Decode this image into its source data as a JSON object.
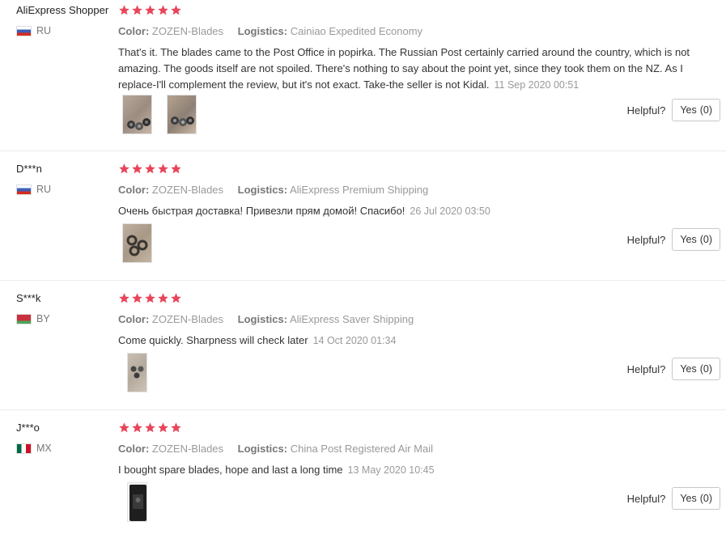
{
  "colors": {
    "star": "#e8455a",
    "muted": "#999999",
    "border": "#ebebeb"
  },
  "labels": {
    "color": "Color:",
    "logistics": "Logistics:",
    "helpful": "Helpful?",
    "yes": "Yes"
  },
  "reviews": [
    {
      "user": "AliExpress Shopper",
      "country": "RU",
      "flag": "flag-ru",
      "rating": 5,
      "color": "ZOZEN-Blades",
      "logistics": "Cainiao Expedited Economy",
      "text": "That's it. The blades came to the Post Office in popirka. The Russian Post certainly carried around the country, which is not amazing. The goods itself are not spoiled. There's nothing to say about the point yet, since they took them on the NZ. As I replace-I'll complement the review, but it's not exact. Take-the seller is not Kidal.",
      "date": "11 Sep 2020 00:51",
      "helpful_count": "(0)",
      "photos": [
        "blades-photo-1",
        "blades-photo-2"
      ]
    },
    {
      "user": "D***n",
      "country": "RU",
      "flag": "flag-ru",
      "rating": 5,
      "color": "ZOZEN-Blades",
      "logistics": "AliExpress Premium Shipping",
      "text": "Очень быстрая доставка! Привезли прям домой! Спасибо!",
      "date": "26 Jul 2020 03:50",
      "helpful_count": "(0)",
      "photos": [
        "blades-photo-3"
      ]
    },
    {
      "user": "S***k",
      "country": "BY",
      "flag": "flag-by",
      "rating": 5,
      "color": "ZOZEN-Blades",
      "logistics": "AliExpress Saver Shipping",
      "text": "Come quickly. Sharpness will check later",
      "date": "14 Oct 2020 01:34",
      "helpful_count": "(0)",
      "photos": [
        "blades-photo-4"
      ]
    },
    {
      "user": "J***o",
      "country": "MX",
      "flag": "flag-mx",
      "rating": 5,
      "color": "ZOZEN-Blades",
      "logistics": "China Post Registered Air Mail",
      "text": "I bought spare blades, hope and last a long time",
      "date": "13 May 2020 10:45",
      "helpful_count": "(0)",
      "photos": [
        "package-photo-1"
      ]
    }
  ]
}
